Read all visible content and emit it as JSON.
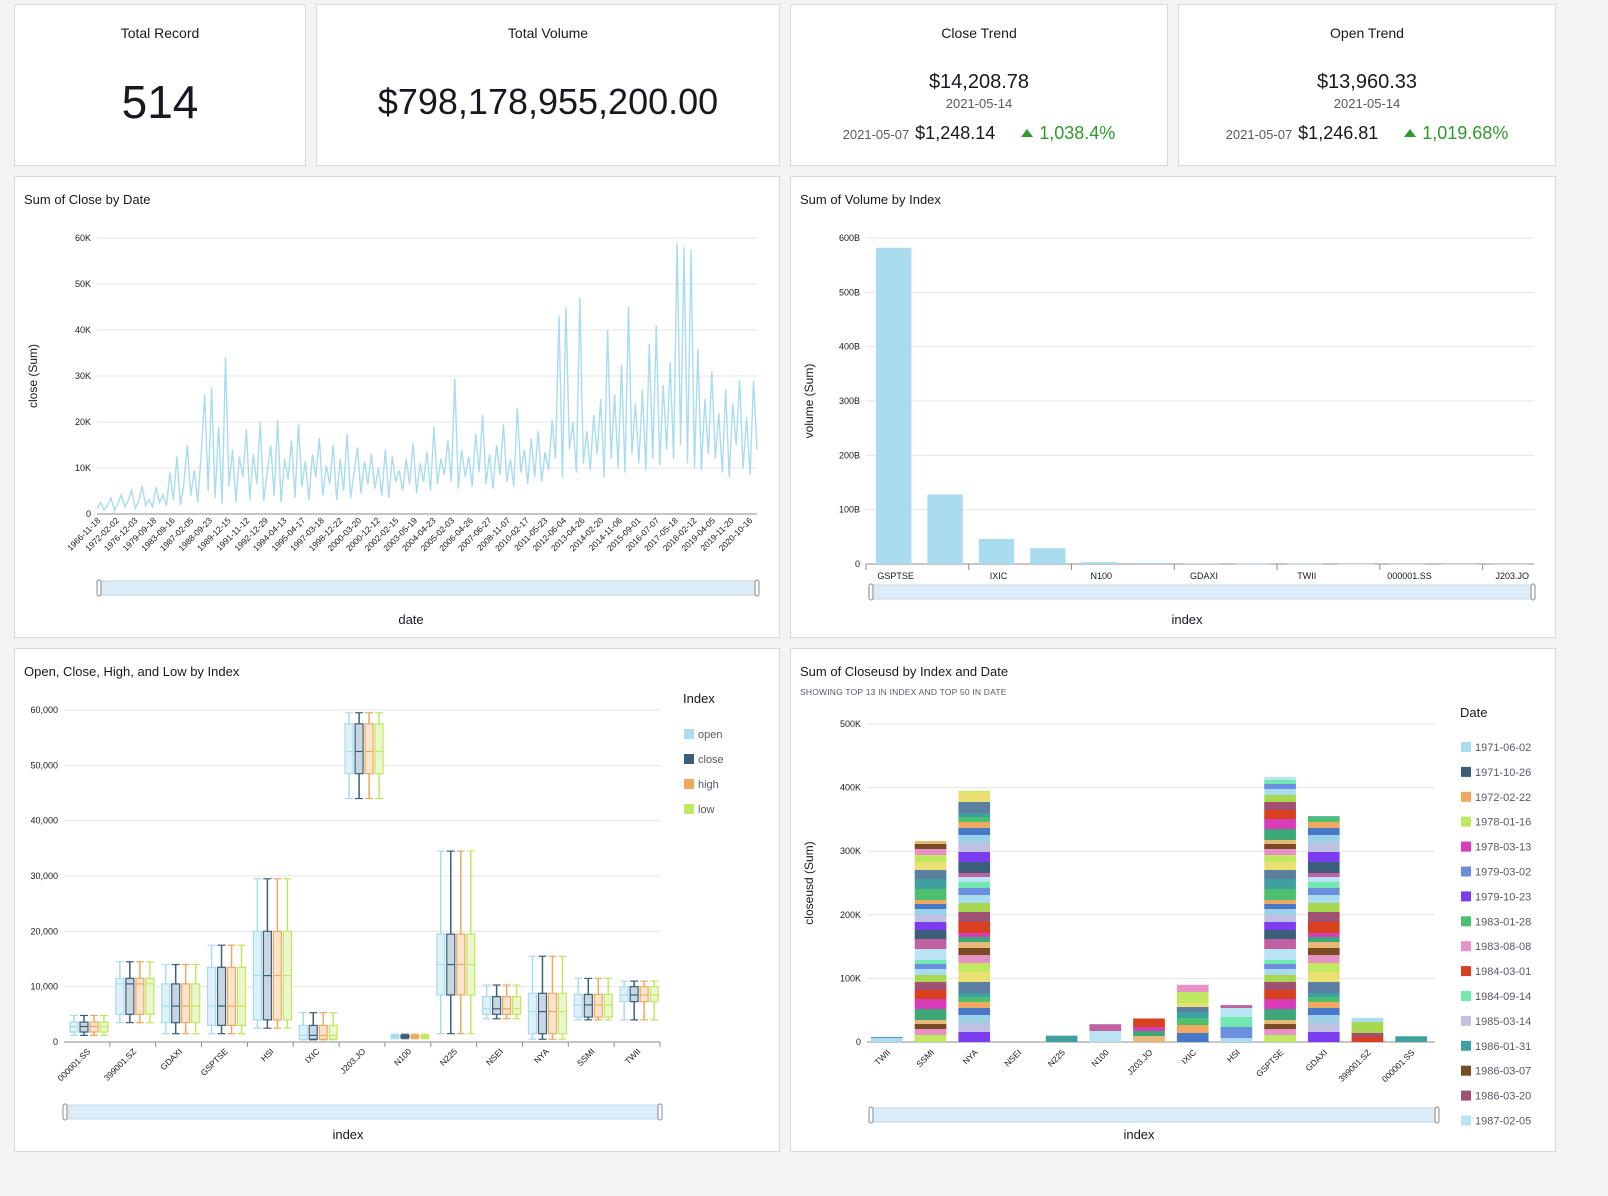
{
  "kpis": {
    "total_record": {
      "title": "Total Record",
      "value": "514"
    },
    "total_volume": {
      "title": "Total Volume",
      "value": "$798,178,955,200.00"
    },
    "close_trend": {
      "title": "Close Trend",
      "value": "$14,208.78",
      "date": "2021-05-14",
      "prev_date": "2021-05-07",
      "prev_value": "$1,248.14",
      "change": "1,038.4%"
    },
    "open_trend": {
      "title": "Open Trend",
      "value": "$13,960.33",
      "date": "2021-05-14",
      "prev_date": "2021-05-07",
      "prev_value": "$1,246.81",
      "change": "1,019.68%"
    }
  },
  "colors": {
    "accent_blue": "#a8dcee",
    "positive": "#2e9a2e",
    "scroll": "#dcecf8"
  },
  "chart_data": [
    {
      "id": "close-by-date",
      "type": "line",
      "title": "Sum of Close by Date",
      "xlabel": "date",
      "ylabel": "close (Sum)",
      "ylim": [
        0,
        60000
      ],
      "yticks": [
        "0",
        "10K",
        "20K",
        "30K",
        "40K",
        "50K",
        "60K"
      ],
      "xticks": [
        "1966-11-18",
        "1972-02-02",
        "1976-12-03",
        "1979-09-18",
        "1983-09-16",
        "1987-02-05",
        "1988-09-23",
        "1989-12-15",
        "1991-11-12",
        "1992-12-29",
        "1994-04-13",
        "1995-04-17",
        "1997-03-18",
        "1998-12-22",
        "2000-03-20",
        "2000-12-12",
        "2002-02-15",
        "2003-05-19",
        "2004-04-23",
        "2005-02-03",
        "2006-04-26",
        "2007-06-27",
        "2008-11-07",
        "2010-02-17",
        "2011-05-23",
        "2012-06-04",
        "2013-04-26",
        "2014-02-20",
        "2014-11-06",
        "2015-09-01",
        "2016-07-07",
        "2017-05-18",
        "2018-02-12",
        "2019-04-05",
        "2019-11-20",
        "2020-10-16"
      ],
      "series": [
        {
          "values": [
            1200,
            2500,
            900,
            1800,
            3500,
            800,
            2200,
            4200,
            1500,
            3000,
            5200,
            1200,
            2800,
            6000,
            1800,
            3200,
            1500,
            5800,
            2500,
            4200,
            1800,
            9000,
            3000,
            12500,
            2000,
            6500,
            15000,
            4000,
            9500,
            2500,
            13000,
            26000,
            5000,
            27500,
            3500,
            19000,
            2200,
            34000,
            6000,
            14000,
            2500,
            12500,
            8000,
            18500,
            3000,
            13000,
            6500,
            20000,
            2800,
            9000,
            15000,
            4000,
            20500,
            2500,
            12000,
            7500,
            16000,
            3500,
            19500,
            6000,
            11500,
            3000,
            13000,
            8000,
            16500,
            4000,
            10500,
            6500,
            15000,
            3000,
            12000,
            5000,
            17500,
            3500,
            9000,
            14500,
            4500,
            11500,
            6500,
            13000,
            5500,
            10000,
            4000,
            14000,
            3500,
            12500,
            7000,
            9500,
            5000,
            12000,
            6500,
            15500,
            4500,
            11000,
            7000,
            13500,
            5000,
            19000,
            6500,
            12000,
            8500,
            16000,
            7000,
            29500,
            5500,
            14000,
            8000,
            12500,
            6000,
            17500,
            9000,
            21500,
            6500,
            13000,
            5500,
            15000,
            8500,
            19500,
            7000,
            12000,
            6000,
            23000,
            9000,
            14000,
            6500,
            16500,
            8000,
            18000,
            7000,
            13500,
            9500,
            20500,
            12000,
            43000,
            8000,
            45000,
            14000,
            20000,
            9000,
            47000,
            11000,
            18000,
            9500,
            21500,
            13000,
            25000,
            8000,
            40000,
            12000,
            26000,
            10000,
            32500,
            9000,
            45000,
            13000,
            24000,
            11000,
            27000,
            9500,
            37000,
            12000,
            41000,
            10500,
            28000,
            14000,
            33000,
            12000,
            59000,
            15000,
            58000,
            11000,
            57500,
            10000,
            36000,
            9500,
            25000,
            13000,
            31000,
            12000,
            22000,
            9000,
            27000,
            8000,
            24000,
            15000,
            29000,
            10000,
            21000,
            8500,
            29000,
            14000
          ]
        }
      ]
    },
    {
      "id": "volume-by-index",
      "type": "bar",
      "title": "Sum of Volume by Index",
      "xlabel": "index",
      "ylabel": "volume (Sum)",
      "ylim": [
        0,
        600000000000
      ],
      "yticks": [
        "0",
        "100B",
        "200B",
        "300B",
        "400B",
        "500B",
        "600B"
      ],
      "categories": [
        "GSPTSE",
        "",
        "IXIC",
        "",
        "N100",
        "",
        "GDAXI",
        "",
        "TWII",
        "",
        "000001.SS",
        "",
        "J203.JO"
      ],
      "values": [
        582000000000,
        128000000000,
        46000000000,
        29000000000,
        3500000000,
        2000000000,
        1200000000,
        700000000,
        400000000,
        200000000,
        100000000,
        50000000,
        20000000
      ]
    },
    {
      "id": "ohlc-by-index",
      "type": "box",
      "title": "Open, Close, High, and Low by Index",
      "xlabel": "index",
      "ylim": [
        0,
        60000
      ],
      "yticks": [
        "0",
        "10,000",
        "20,000",
        "30,000",
        "40,000",
        "50,000",
        "60,000"
      ],
      "legend_title": "Index",
      "legend_position": "right",
      "series_names": [
        "open",
        "close",
        "high",
        "low"
      ],
      "series_colors": [
        "#a8dcee",
        "#3b5f7a",
        "#f0a860",
        "#c0e860"
      ],
      "categories": [
        "000001.SS",
        "399001.SZ",
        "GDAXI",
        "GSPTSE",
        "HSI",
        "IXIC",
        "J203.JO",
        "N100",
        "N225",
        "NSEI",
        "NYA",
        "SSMI",
        "TWII"
      ],
      "stats": [
        {
          "min": 1200,
          "q1": 1800,
          "med": 2800,
          "q3": 3600,
          "max": 4800
        },
        {
          "min": 3500,
          "q1": 5000,
          "med": 10500,
          "q3": 11500,
          "max": 14500
        },
        {
          "min": 1500,
          "q1": 3500,
          "med": 6500,
          "q3": 10500,
          "max": 14000
        },
        {
          "min": 1500,
          "q1": 3000,
          "med": 6500,
          "q3": 13500,
          "max": 17500
        },
        {
          "min": 2500,
          "q1": 4000,
          "med": 12000,
          "q3": 20000,
          "max": 29500
        },
        {
          "min": 400,
          "q1": 500,
          "med": 1200,
          "q3": 3000,
          "max": 5300
        },
        {
          "min": 44000,
          "q1": 48500,
          "med": 52500,
          "q3": 57500,
          "max": 59500
        },
        {
          "min": 600,
          "q1": 800,
          "med": 1000,
          "q3": 1200,
          "max": 1400
        },
        {
          "min": 1500,
          "q1": 8500,
          "med": 14000,
          "q3": 19500,
          "max": 34500
        },
        {
          "min": 4200,
          "q1": 5000,
          "med": 6000,
          "q3": 8200,
          "max": 10300
        },
        {
          "min": 500,
          "q1": 1500,
          "med": 5500,
          "q3": 8800,
          "max": 15500
        },
        {
          "min": 4000,
          "q1": 4500,
          "med": 6700,
          "q3": 8600,
          "max": 11500
        },
        {
          "min": 4000,
          "q1": 7300,
          "med": 8500,
          "q3": 10000,
          "max": 11000
        }
      ]
    },
    {
      "id": "closeusd-by-index-date",
      "type": "bar",
      "stacked": true,
      "title": "Sum of Closeusd by Index and Date",
      "subtitle": "SHOWING TOP 13 IN INDEX AND TOP 50 IN DATE",
      "xlabel": "index",
      "ylabel": "closeusd (Sum)",
      "ylim": [
        0,
        500000
      ],
      "yticks": [
        "0",
        "100K",
        "200K",
        "300K",
        "400K",
        "500K"
      ],
      "categories": [
        "TWII",
        "SSMI",
        "NYA",
        "NSEI",
        "N225",
        "N100",
        "J203.JO",
        "IXIC",
        "HSI",
        "GSPTSE",
        "GDAXI",
        "399001.SZ",
        "000001.SS"
      ],
      "values": [
        8000,
        316000,
        395000,
        0,
        10000,
        28000,
        37000,
        90000,
        58000,
        417000,
        355000,
        38000,
        9000
      ],
      "legend_title": "Date",
      "legend_position": "right",
      "legend": [
        {
          "label": "1971-06-02",
          "color": "#a8dcee"
        },
        {
          "label": "1971-10-26",
          "color": "#3b5f7a"
        },
        {
          "label": "1972-02-22",
          "color": "#f0a860"
        },
        {
          "label": "1978-01-16",
          "color": "#c0e860"
        },
        {
          "label": "1978-03-13",
          "color": "#d83cb8"
        },
        {
          "label": "1979-03-02",
          "color": "#6b8ee0"
        },
        {
          "label": "1979-10-23",
          "color": "#7c3cf0"
        },
        {
          "label": "1983-01-28",
          "color": "#4cc070"
        },
        {
          "label": "1983-08-08",
          "color": "#e890c8"
        },
        {
          "label": "1984-03-01",
          "color": "#d84020"
        },
        {
          "label": "1984-09-14",
          "color": "#70e8b0"
        },
        {
          "label": "1985-03-14",
          "color": "#c0c0e0"
        },
        {
          "label": "1986-01-31",
          "color": "#40a0a0"
        },
        {
          "label": "1986-03-07",
          "color": "#7a4a20"
        },
        {
          "label": "1986-03-20",
          "color": "#a05070"
        },
        {
          "label": "1987-02-05",
          "color": "#b8e4f4"
        }
      ]
    }
  ]
}
